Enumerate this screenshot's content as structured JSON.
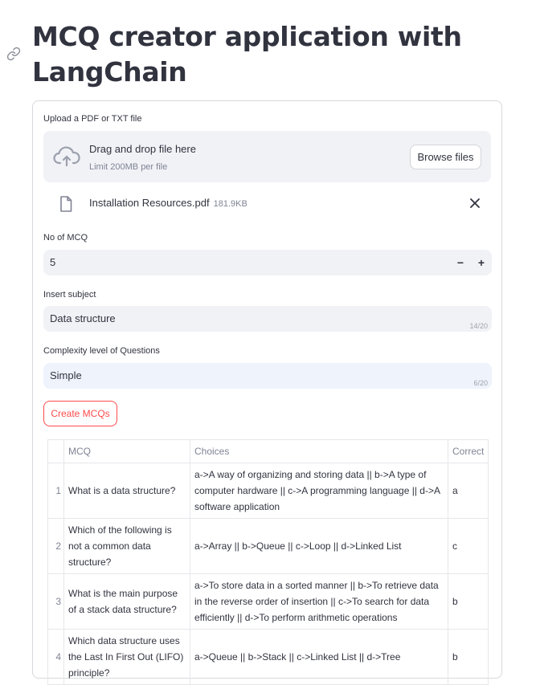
{
  "page": {
    "title": "MCQ creator application with LangChain"
  },
  "upload": {
    "label": "Upload a PDF or TXT file",
    "drop_text": "Drag and drop file here",
    "limit_text": "Limit 200MB per file",
    "browse_label": "Browse files",
    "file_name": "Installation Resources.pdf",
    "file_size": "181.9KB"
  },
  "num_mcq": {
    "label": "No of MCQ",
    "value": "5",
    "minus": "−",
    "plus": "+"
  },
  "subject": {
    "label": "Insert subject",
    "value": "Data structure",
    "count": "14/20"
  },
  "complexity": {
    "label": "Complexity level of Questions",
    "value": "Simple",
    "count": "6/20"
  },
  "create_button": "Create MCQs",
  "table": {
    "headers": {
      "index": "",
      "mcq": "MCQ",
      "choices": "Choices",
      "correct": "Correct"
    },
    "rows": [
      {
        "index": "1",
        "mcq": "What is a data structure?",
        "choices": "a->A way of organizing and storing data || b->A type of computer hardware || c->A programming language || d->A software application",
        "correct": "a"
      },
      {
        "index": "2",
        "mcq": "Which of the following is not a common data structure?",
        "choices": "a->Array || b->Queue || c->Loop || d->Linked List",
        "correct": "c"
      },
      {
        "index": "3",
        "mcq": "What is the main purpose of a stack data structure?",
        "choices": "a->To store data in a sorted manner || b->To retrieve data in the reverse order of insertion || c->To search for data efficiently || d->To perform arithmetic operations",
        "correct": "b"
      },
      {
        "index": "4",
        "mcq": "Which data structure uses the Last In First Out (LIFO) principle?",
        "choices": "a->Queue || b->Stack || c->Linked List || d->Tree",
        "correct": "b"
      }
    ]
  },
  "colors": {
    "accent": "#ff4b4b",
    "field_bg": "#f0f2f6",
    "text": "#31333f"
  }
}
